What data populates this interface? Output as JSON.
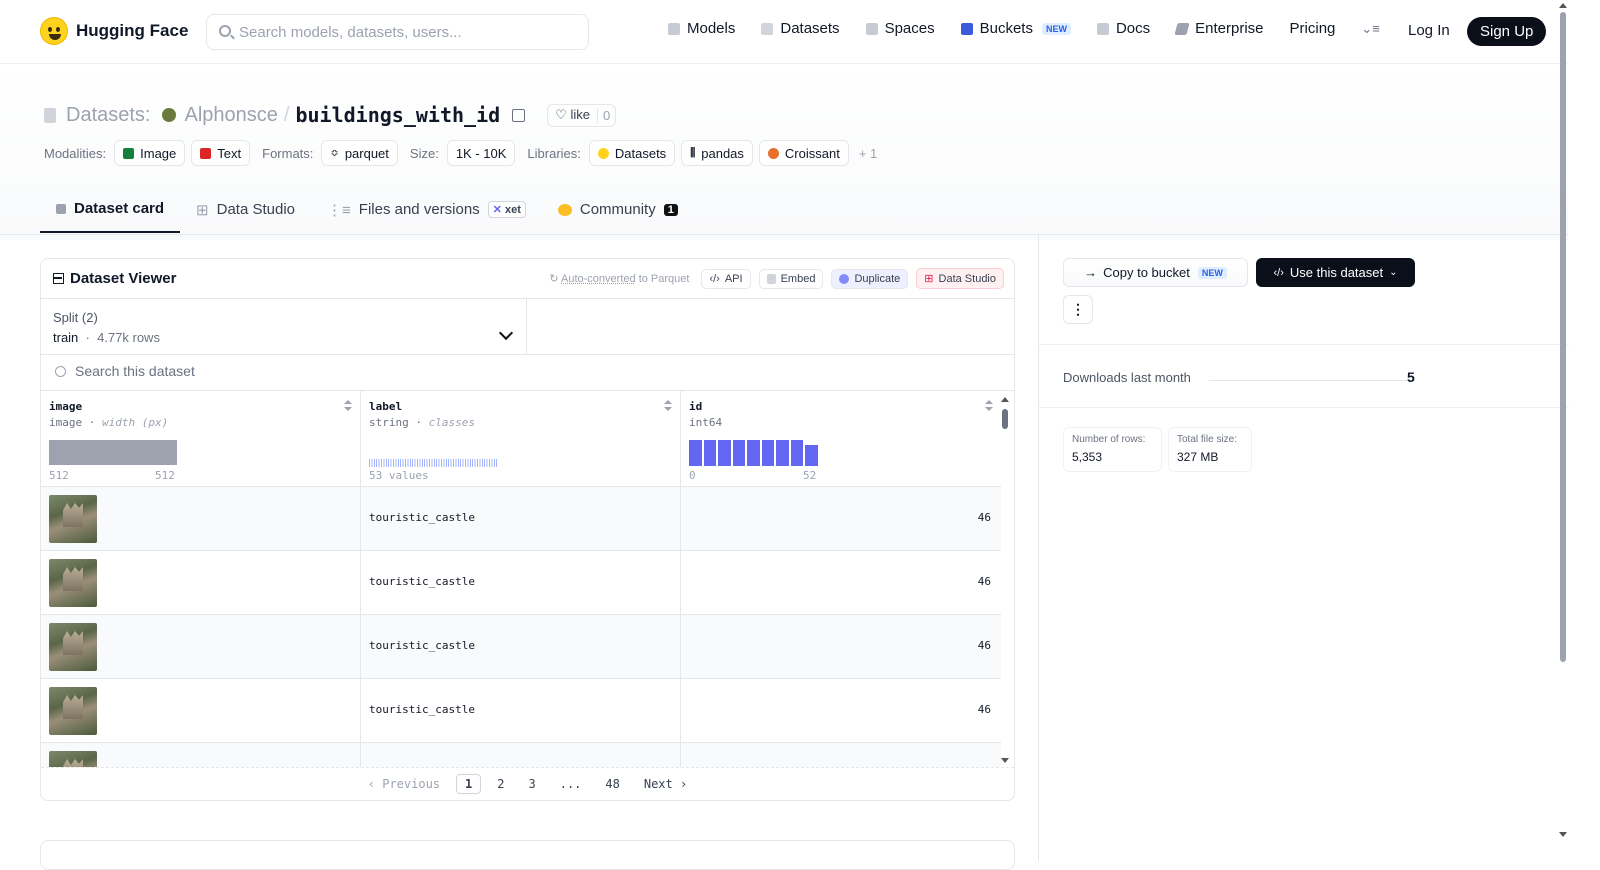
{
  "nav": {
    "brand": "Hugging Face",
    "search_placeholder": "Search models, datasets, users...",
    "links": [
      "Models",
      "Datasets",
      "Spaces",
      "Buckets",
      "Docs",
      "Enterprise",
      "Pricing"
    ],
    "buckets_badge": "NEW",
    "login": "Log In",
    "signup": "Sign Up"
  },
  "header": {
    "prefix": "Datasets:",
    "owner": "Alphonsce",
    "sep": "/",
    "name": "buildings_with_id",
    "like_label": "like",
    "like_count": "0",
    "modalities_label": "Modalities:",
    "modalities": [
      "Image",
      "Text"
    ],
    "formats_label": "Formats:",
    "format": "parquet",
    "size_label": "Size:",
    "size": "1K - 10K",
    "libraries_label": "Libraries:",
    "libraries": [
      "Datasets",
      "pandas",
      "Croissant"
    ],
    "more_libraries": "+ 1"
  },
  "tabs": {
    "dataset_card": "Dataset card",
    "data_studio": "Data Studio",
    "files": "Files and versions",
    "xet": "xet",
    "community": "Community",
    "community_count": "1"
  },
  "viewer": {
    "title": "Dataset Viewer",
    "auto_converted_a": "Auto-converted",
    "auto_converted_b": "to Parquet",
    "api": "API",
    "embed": "Embed",
    "duplicate": "Duplicate",
    "data_studio": "Data Studio",
    "split_label": "Split (2)",
    "split_value": "train",
    "split_rows": "4.77k rows",
    "search_placeholder": "Search this dataset",
    "columns": [
      {
        "name": "image",
        "type": "image",
        "sub": "width (px)",
        "min": "512",
        "max": "512"
      },
      {
        "name": "label",
        "type": "string",
        "sub": "classes",
        "summary": "53 values"
      },
      {
        "name": "id",
        "type": "int64",
        "min": "0",
        "max": "52"
      }
    ],
    "id_hist": [
      1,
      1,
      1,
      1,
      1,
      1,
      1,
      1,
      0.8
    ],
    "rows": [
      {
        "label": "touristic_castle",
        "id": "46"
      },
      {
        "label": "touristic_castle",
        "id": "46"
      },
      {
        "label": "touristic_castle",
        "id": "46"
      },
      {
        "label": "touristic_castle",
        "id": "46"
      }
    ],
    "pager": {
      "prev": "Previous",
      "pages": [
        "1",
        "2",
        "3",
        "...",
        "48"
      ],
      "next": "Next"
    }
  },
  "sidebar": {
    "copy_bucket": "Copy to bucket",
    "copy_badge": "NEW",
    "use_dataset": "Use this dataset",
    "downloads_label": "Downloads last month",
    "downloads_value": "5",
    "rows_label": "Number of rows:",
    "rows_value": "5,353",
    "filesize_label": "Total file size:",
    "filesize_value": "327 MB"
  }
}
